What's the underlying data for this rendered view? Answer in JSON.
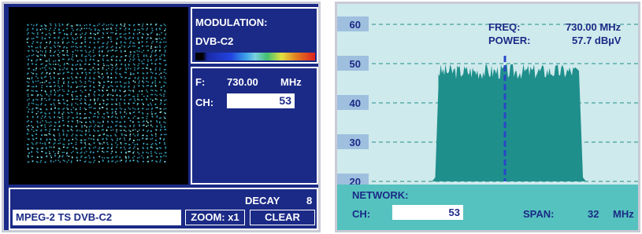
{
  "left_panel": {
    "modulation_label": "MODULATION:",
    "modulation_value": "DVB-C2",
    "frequency_label": "F:",
    "frequency_value": "730.00",
    "frequency_unit": "MHz",
    "channel_label": "CH:",
    "channel_value": "53",
    "decay_label": "DECAY",
    "decay_value": "8",
    "transport_stream": "MPEG-2 TS DVB-C2",
    "zoom_label": "ZOOM: x1",
    "clear_label": "CLEAR",
    "colors": {
      "background": "#1b2a86",
      "constellation_points": "#3ec3e8"
    }
  },
  "right_panel": {
    "freq_label": "FREQ:",
    "freq_value": "730.00 MHz",
    "power_label": "POWER:",
    "power_value": "57.7  dBµV",
    "network_label": "NETWORK:",
    "channel_label": "CH:",
    "channel_value": "53",
    "span_label": "SPAN:",
    "span_value": "32",
    "span_unit": "MHz",
    "y_ticks": [
      "60",
      "50",
      "40",
      "30",
      "20"
    ],
    "colors": {
      "background": "#cfeaec",
      "spectrum": "#1f8f8c",
      "marker": "#2a47c8",
      "grid": "#1f8f8c"
    }
  },
  "chart_data": {
    "type": "area",
    "ylim": [
      20,
      60
    ],
    "yticks": [
      60,
      50,
      40,
      30,
      20
    ],
    "marker_freq_mhz": 730.0,
    "span_mhz": 32,
    "channel_start_mhz": 722,
    "channel_end_mhz": 739,
    "channel_level": 48,
    "skirt_level": 21
  }
}
